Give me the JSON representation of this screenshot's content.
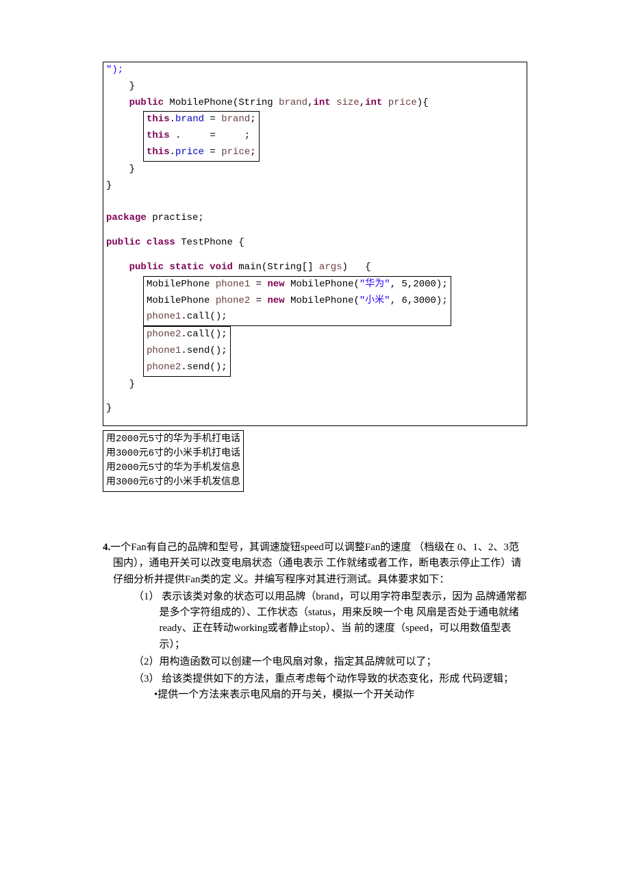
{
  "code1": {
    "l1": "\");",
    "l2": "    }",
    "l3a": "    ",
    "l3b": "public",
    "l3c": " MobilePhone(String ",
    "l3d": "brand",
    "l3e": ",",
    "l3f": "int",
    "l3g": " ",
    "l3h": "size",
    "l3i": ",",
    "l3j": "int",
    "l3k": " ",
    "l3l": "price",
    "l3m": "){",
    "l4a": "this",
    "l4b": ".",
    "l4c": "brand",
    "l4d": " = ",
    "l4e": "brand",
    "l4f": ";",
    "l5a": "this",
    "l5b": " .     =     ;",
    "l6a": "this",
    "l6b": ".",
    "l6c": "price",
    "l6d": " = ",
    "l6e": "price",
    "l6f": ";",
    "l7": "    }",
    "l8": "}",
    "l9": "",
    "l10": "",
    "l11a": "package",
    "l11b": " practise;",
    "l12": "",
    "l13a": "public",
    "l13b": " ",
    "l13c": "class",
    "l13d": " TestPhone {",
    "l14": "",
    "l15a": "    ",
    "l15b": "public",
    "l15c": " ",
    "l15d": "static",
    "l15e": " ",
    "l15f": "void",
    "l15g": " main(String[] ",
    "l15h": "args",
    "l15i": ")   {",
    "l16a": "MobilePhone ",
    "l16b": "phone1",
    "l16c": " = ",
    "l16d": "new",
    "l16e": " MobilePhone(",
    "l16f": "\"华为\"",
    "l16g": ", 5,2000);",
    "l17a": "MobilePhone ",
    "l17b": "phone2",
    "l17c": " = ",
    "l17d": "new",
    "l17e": " MobilePhone(",
    "l17f": "\"小米\"",
    "l17g": ", 6,3000);",
    "l18a": "phone1",
    "l18b": ".call();",
    "l19a": "phone2",
    "l19b": ".call();",
    "l20a": "phone1",
    "l20b": ".send();",
    "l21a": "phone2",
    "l21b": ".send();",
    "l22": "    }",
    "l23": "",
    "l24": "}"
  },
  "output": {
    "o1": "用2000元5寸的华为手机打电话",
    "o2": "用3000元6寸的小米手机打电话",
    "o3": "用2000元5寸的华为手机发信息",
    "o4": "用3000元6寸的小米手机发信息"
  },
  "question": {
    "num": "4.",
    "body": "一个Fan有自己的品牌和型号，其调速旋钮speed可以调整Fan的速度 （档级在 0、1、2、3范围内），通电开关可以改变电扇状态（通电表示 工作就绪或者工作，断电表示停止工作）请仔细分析并提供Fan类的定 义。并编写程序对其进行测试。具体要求如下：",
    "i1n": "（1）",
    "i1": "    表示该类对象的状态可以用品牌（brand，可以用字符串型表示，因为 品牌通常都是多个字符组成的）、工作状态（status，用来反映一个电 风扇是否处于通电就绪ready、正在转动working或者静止stop）、当 前的速度（speed，可以用数值型表示）；",
    "i2": "（2）用构造函数可以创建一个电风扇对象，指定其品牌就可以了；",
    "i3n": "（3）",
    "i3": "    给该类提供如下的方法，重点考虑每个动作导致的状态变化，形成 代码逻辑；",
    "s1": "•提供一个方法来表示电风扇的开与关，模拟一个开关动作"
  }
}
